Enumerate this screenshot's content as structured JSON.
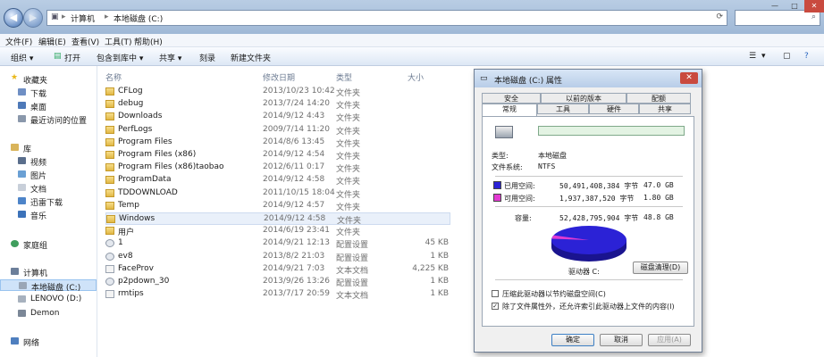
{
  "address": {
    "parts": [
      "计算机",
      "本地磁盘 (C:)"
    ],
    "separator": "▸"
  },
  "window_buttons": [
    "—",
    "□",
    "✕"
  ],
  "menu": [
    "文件(F)",
    "编辑(E)",
    "查看(V)",
    "工具(T)",
    "帮助(H)"
  ],
  "toolbar": {
    "organize": "组织 ▾",
    "open": "打开",
    "include": "包含到库中 ▾",
    "share": "共享 ▾",
    "burn": "刻录",
    "new_folder": "新建文件夹"
  },
  "sidebar": {
    "favorites": "收藏夹",
    "fav_items": [
      "下载",
      "桌面",
      "最近访问的位置"
    ],
    "library": "库",
    "lib_items": [
      "视频",
      "图片",
      "文档",
      "迅雷下载",
      "音乐"
    ],
    "homegroup": "家庭组",
    "computer": "计算机",
    "drives": [
      "本地磁盘 (C:)",
      "LENOVO (D:)",
      "Demon"
    ],
    "network": "网络"
  },
  "columns": {
    "name": "名称",
    "date": "修改日期",
    "type": "类型",
    "size": "大小"
  },
  "files": [
    {
      "name": "CFLog",
      "date": "2013/10/23 10:42",
      "type": "文件夹",
      "size": "",
      "kind": "folder"
    },
    {
      "name": "debug",
      "date": "2013/7/24 14:20",
      "type": "文件夹",
      "size": "",
      "kind": "folder"
    },
    {
      "name": "Downloads",
      "date": "2014/9/12 4:43",
      "type": "文件夹",
      "size": "",
      "kind": "folder"
    },
    {
      "name": "PerfLogs",
      "date": "2009/7/14 11:20",
      "type": "文件夹",
      "size": "",
      "kind": "folder"
    },
    {
      "name": "Program Files",
      "date": "2014/8/6 13:45",
      "type": "文件夹",
      "size": "",
      "kind": "folder"
    },
    {
      "name": "Program Files (x86)",
      "date": "2014/9/12 4:54",
      "type": "文件夹",
      "size": "",
      "kind": "folder"
    },
    {
      "name": "Program Files (x86)taobao",
      "date": "2012/6/11 0:17",
      "type": "文件夹",
      "size": "",
      "kind": "folder"
    },
    {
      "name": "ProgramData",
      "date": "2014/9/12 4:58",
      "type": "文件夹",
      "size": "",
      "kind": "folder"
    },
    {
      "name": "TDDOWNLOAD",
      "date": "2011/10/15 18:04",
      "type": "文件夹",
      "size": "",
      "kind": "folder"
    },
    {
      "name": "Temp",
      "date": "2014/9/12 4:57",
      "type": "文件夹",
      "size": "",
      "kind": "folder"
    },
    {
      "name": "Windows",
      "date": "2014/9/12 4:58",
      "type": "文件夹",
      "size": "",
      "kind": "folder"
    },
    {
      "name": "用户",
      "date": "2014/6/19 23:41",
      "type": "文件夹",
      "size": "",
      "kind": "folder"
    },
    {
      "name": "1",
      "date": "2014/9/21 12:13",
      "type": "配置设置",
      "size": "45 KB",
      "kind": "gear"
    },
    {
      "name": "ev8",
      "date": "2013/8/2 21:03",
      "type": "配置设置",
      "size": "1 KB",
      "kind": "gear"
    },
    {
      "name": "FaceProv",
      "date": "2014/9/21 7:03",
      "type": "文本文档",
      "size": "4,225 KB",
      "kind": "file"
    },
    {
      "name": "p2pdown_30",
      "date": "2013/9/26 13:26",
      "type": "配置设置",
      "size": "1 KB",
      "kind": "gear"
    },
    {
      "name": "rmtips",
      "date": "2013/7/17 20:59",
      "type": "文本文档",
      "size": "1 KB",
      "kind": "file"
    }
  ],
  "dialog": {
    "title": "本地磁盘 (C:) 属性",
    "close": "✕",
    "tabs_top": [
      "安全",
      "以前的版本",
      "配额"
    ],
    "tabs_bottom": [
      "常规",
      "工具",
      "硬件",
      "共享"
    ],
    "type_label": "类型:",
    "type_value": "本地磁盘",
    "fs_label": "文件系统:",
    "fs_value": "NTFS",
    "used_label": "已用空间:",
    "used_bytes": "50,491,408,384 字节",
    "used_gb": "47.0 GB",
    "free_label": "可用空间:",
    "free_bytes": "1,937,387,520 字节",
    "free_gb": "1.80 GB",
    "cap_label": "容量:",
    "cap_bytes": "52,428,795,904 字节",
    "cap_gb": "48.8 GB",
    "drive_label": "驱动器 C:",
    "cleanup": "磁盘清理(D)",
    "compress": "压缩此驱动器以节约磁盘空间(C)",
    "index": "除了文件属性外，还允许索引此驱动器上文件的内容(I)",
    "ok": "确定",
    "cancel": "取消",
    "apply": "应用(A)",
    "used_color": "#2b22d6",
    "free_color": "#e23ad2"
  }
}
